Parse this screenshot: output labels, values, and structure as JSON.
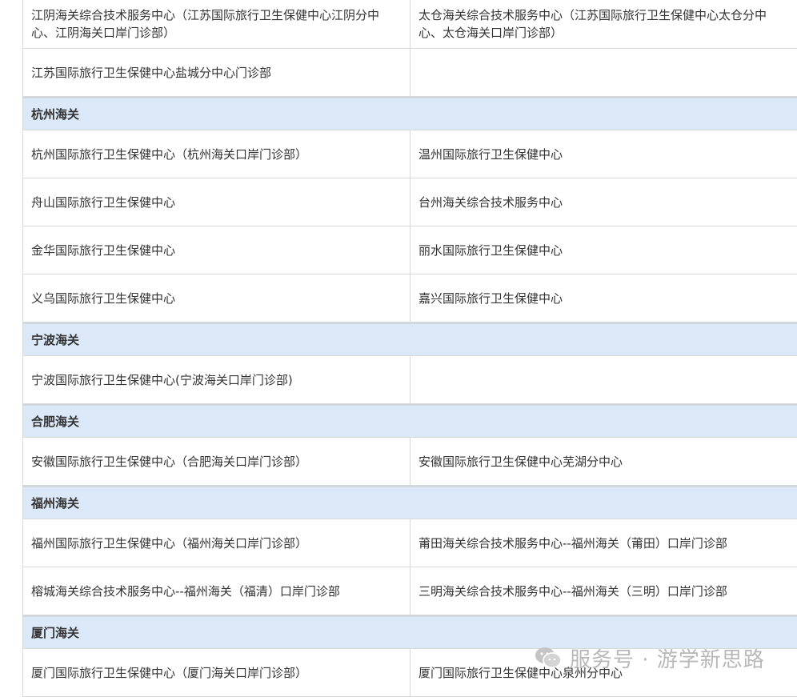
{
  "rows": [
    {
      "type": "data",
      "left": "江阴海关综合技术服务中心（江苏国际旅行卫生保健中心江阴分中心、江阴海关口岸门诊部）",
      "right": "太仓海关综合技术服务中心（江苏国际旅行卫生保健中心太仓分中心、太仓海关口岸门诊部）"
    },
    {
      "type": "data",
      "left": "江苏国际旅行卫生保健中心盐城分中心门诊部",
      "right": ""
    },
    {
      "type": "header",
      "label": "杭州海关"
    },
    {
      "type": "data",
      "left": "杭州国际旅行卫生保健中心（杭州海关口岸门诊部）",
      "right": "温州国际旅行卫生保健中心"
    },
    {
      "type": "data",
      "left": "舟山国际旅行卫生保健中心",
      "right": "台州海关综合技术服务中心"
    },
    {
      "type": "data",
      "left": "金华国际旅行卫生保健中心",
      "right": "丽水国际旅行卫生保健中心"
    },
    {
      "type": "data",
      "left": "义乌国际旅行卫生保健中心",
      "right": "嘉兴国际旅行卫生保健中心"
    },
    {
      "type": "header",
      "label": "宁波海关"
    },
    {
      "type": "data",
      "left": "宁波国际旅行卫生保健中心(宁波海关口岸门诊部)",
      "right": ""
    },
    {
      "type": "header",
      "label": "合肥海关"
    },
    {
      "type": "data",
      "left": "安徽国际旅行卫生保健中心（合肥海关口岸门诊部）",
      "right": "安徽国际旅行卫生保健中心芜湖分中心"
    },
    {
      "type": "header",
      "label": "福州海关"
    },
    {
      "type": "data",
      "left": "福州国际旅行卫生保健中心（福州海关口岸门诊部）",
      "right": "莆田海关综合技术服务中心--福州海关（莆田）口岸门诊部"
    },
    {
      "type": "data",
      "left": "榕城海关综合技术服务中心--福州海关（福清）口岸门诊部",
      "right": "三明海关综合技术服务中心--福州海关（三明）口岸门诊部"
    },
    {
      "type": "header",
      "label": "厦门海关"
    },
    {
      "type": "data",
      "left": "厦门国际旅行卫生保健中心（厦门海关口岸门诊部）",
      "right": "厦门国际旅行卫生保健中心泉州分中心"
    }
  ],
  "watermark": {
    "icon": "wechat-icon",
    "text": "服务号 · 游学新思路"
  }
}
